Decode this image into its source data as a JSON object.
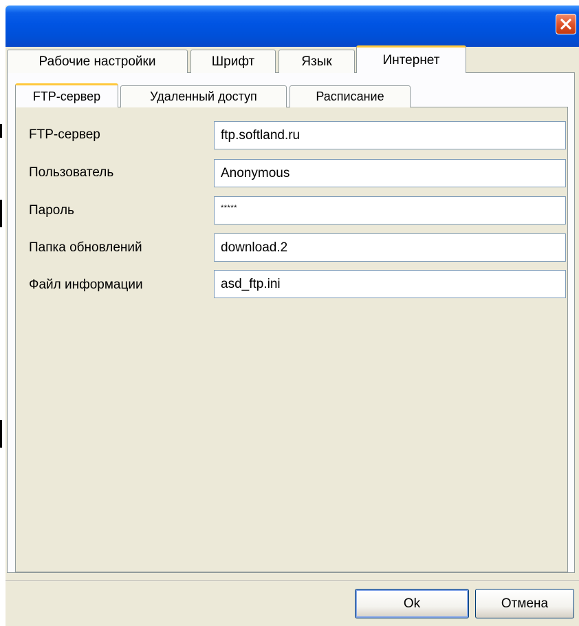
{
  "window": {
    "close_icon": "close-icon"
  },
  "tabs": [
    {
      "label": "Рабочие настройки",
      "active": false
    },
    {
      "label": "Шрифт",
      "active": false
    },
    {
      "label": "Язык",
      "active": false
    },
    {
      "label": "Интернет",
      "active": true
    }
  ],
  "subtabs": [
    {
      "label": "FTP-сервер",
      "active": true
    },
    {
      "label": "Удаленный доступ",
      "active": false
    },
    {
      "label": "Расписание",
      "active": false
    }
  ],
  "form": {
    "fields": [
      {
        "label": "FTP-сервер",
        "value": "ftp.softland.ru"
      },
      {
        "label": "Пользователь",
        "value": "Anonymous"
      },
      {
        "label": "Пароль",
        "value": "*****"
      },
      {
        "label": "Папка обновлений",
        "value": "download.2"
      },
      {
        "label": "Файл информации",
        "value": "asd_ftp.ini"
      }
    ]
  },
  "buttons": {
    "ok_label": "Ok",
    "cancel_label": "Отмена"
  },
  "colors": {
    "titlebar": "#0054e3",
    "dialog_bg": "#ece9d8",
    "active_tab_accent": "#ffc83c",
    "close_button": "#e0532b"
  }
}
